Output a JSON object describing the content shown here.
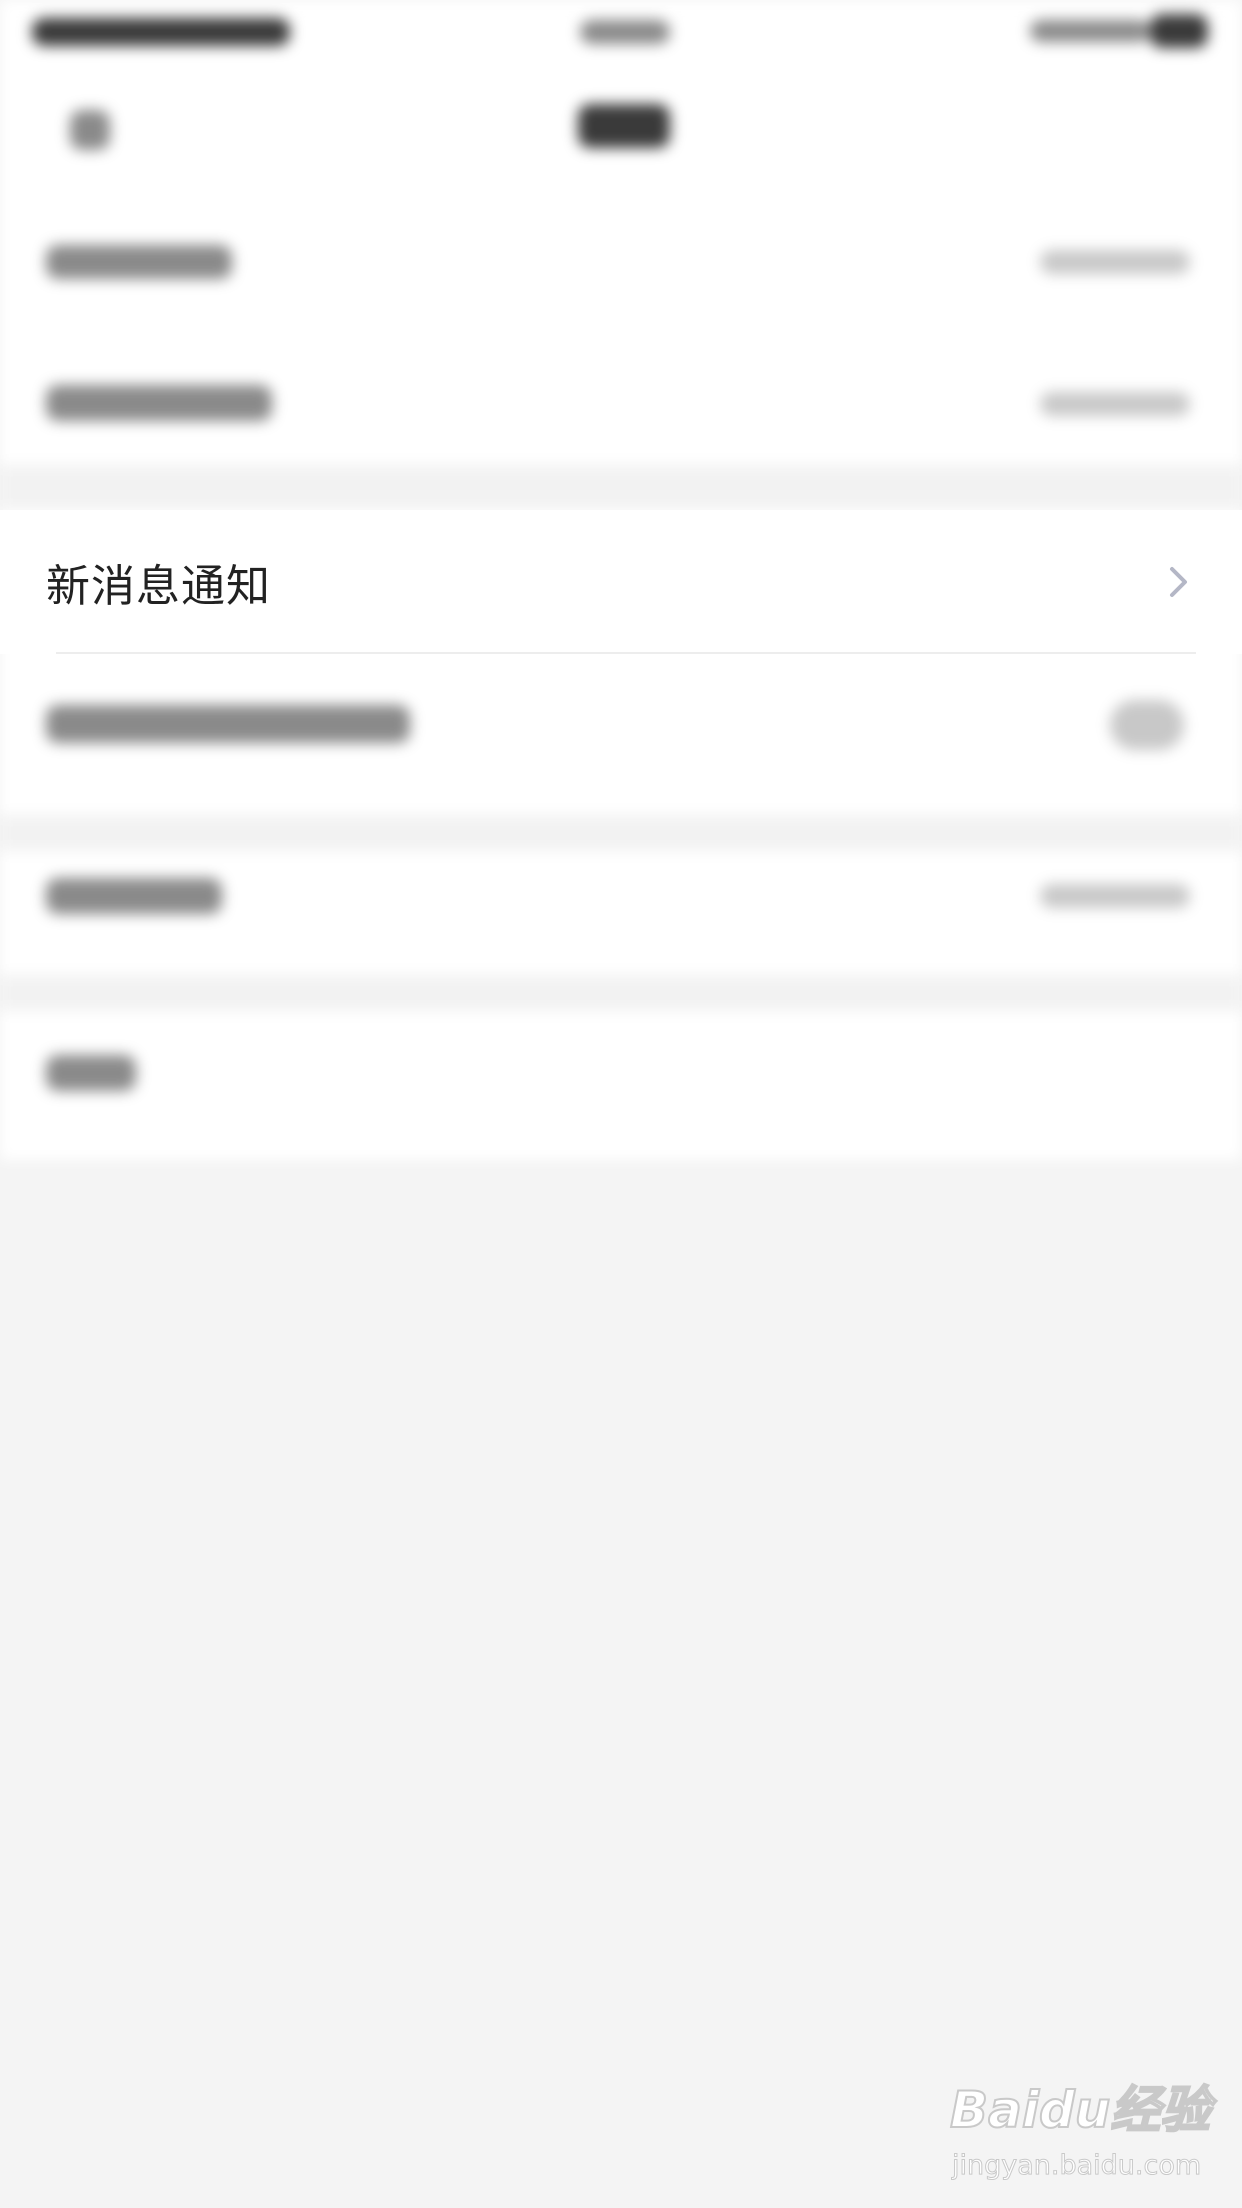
{
  "settings_item": {
    "label": "新消息通知"
  },
  "watermark": {
    "brand": "Baidu经验",
    "url": "jingyan.baidu.com"
  }
}
